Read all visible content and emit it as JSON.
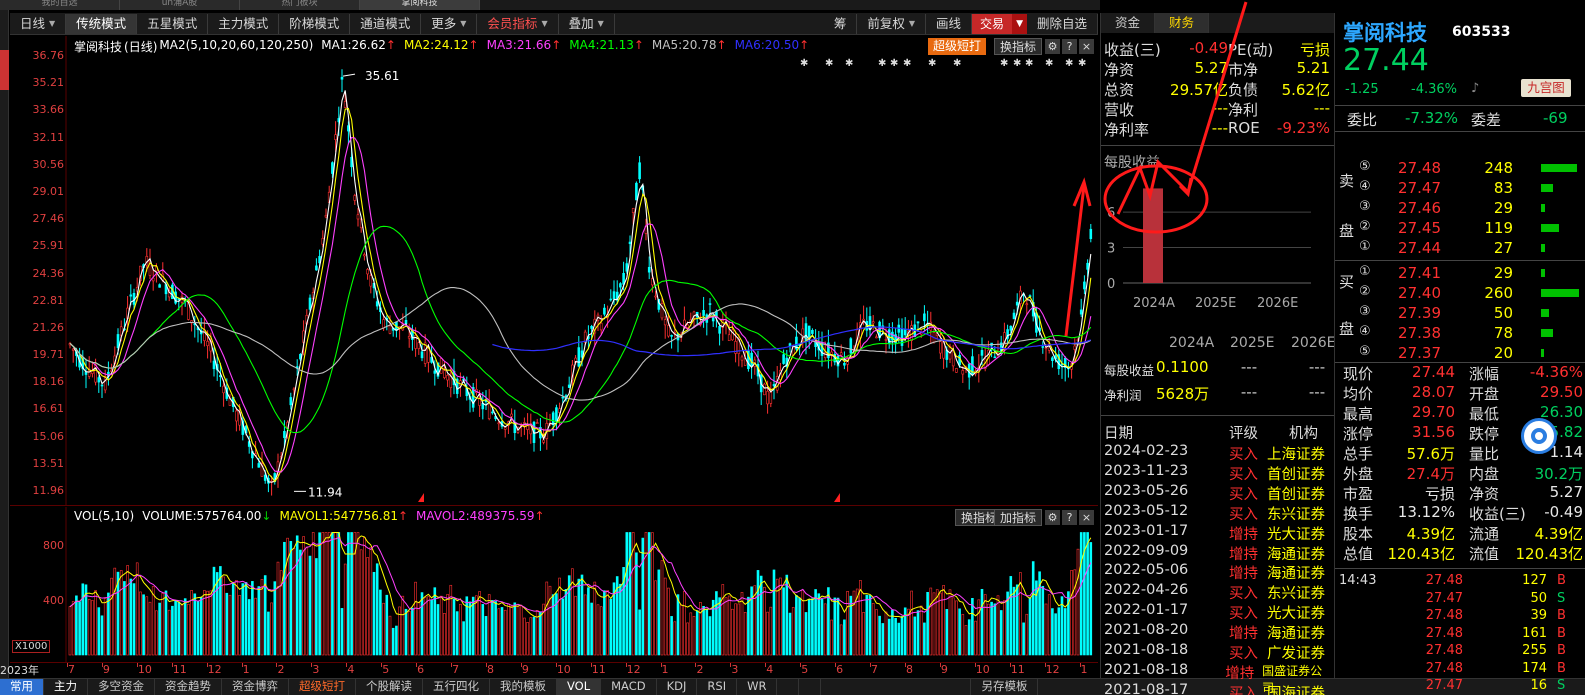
{
  "top_tabs": [
    "我的自选",
    "un浦A股",
    "热门板块",
    "掌阅科技"
  ],
  "mode_bar": {
    "items": [
      "日线",
      "传统模式",
      "五星模式",
      "主力模式",
      "阶梯模式",
      "通道模式",
      "更多",
      "会员指标",
      "叠加"
    ],
    "right": [
      "筹",
      "前复权",
      "画线",
      "交易",
      "删除自选"
    ]
  },
  "chart": {
    "name": "掌阅科技",
    "period": "(日线)",
    "ma_label": "MA2(5,10,20,60,120,250)",
    "ma": [
      {
        "label": "MA1:26.62",
        "color": "#ffffff"
      },
      {
        "label": "MA2:24.12",
        "color": "#ffff00"
      },
      {
        "label": "MA3:21.66",
        "color": "#ff40ff"
      },
      {
        "label": "MA4:21.13",
        "color": "#00ff00"
      },
      {
        "label": "MA5:20.78",
        "color": "#c0c0c0"
      },
      {
        "label": "MA6:20.50",
        "color": "#3030ff"
      }
    ],
    "super_btn": "超级短打",
    "indicator_btn": "换指标",
    "y_ticks": [
      "36.76",
      "35.21",
      "33.66",
      "32.11",
      "30.56",
      "29.01",
      "27.46",
      "25.91",
      "24.36",
      "22.81",
      "21.26",
      "19.71",
      "18.16",
      "16.61",
      "15.06",
      "13.51",
      "11.96"
    ],
    "high_label": "35.61",
    "low_label": "11.94"
  },
  "volume": {
    "label": "VOL(5,10)",
    "volume_text": "VOLUME:575764.00",
    "mavol1": "MAVOL1:547756.81",
    "mavol2": "MAVOL2:489375.59",
    "y_ticks": [
      "800",
      "400"
    ],
    "unit": "X1000",
    "change_indicator": "换指标",
    "add_indicator": "加指标"
  },
  "months": [
    "7",
    "9",
    "10",
    "11",
    "12",
    "1",
    "2",
    "3",
    "4",
    "5",
    "6",
    "7",
    "8",
    "9",
    "10",
    "11",
    "12",
    "1",
    "2",
    "3",
    "4",
    "5",
    "6",
    "7",
    "8",
    "9",
    "10",
    "11",
    "12",
    "1"
  ],
  "year_label": "2023年",
  "bottom_tabs": [
    "常用",
    "主力",
    "多空资金",
    "资金趋势",
    "资金博弈",
    "超级短打",
    "个股解读",
    "五行四化",
    "我的模板",
    "VOL",
    "MACD",
    "KDJ",
    "RSI",
    "WR",
    "",
    "",
    "",
    "另存模板"
  ],
  "finance": {
    "tabs": [
      "资金",
      "财务"
    ],
    "rows": [
      {
        "l1": "收益(三)",
        "v1": "-0.49",
        "l2": "PE(动)",
        "v2": "亏损"
      },
      {
        "l1": "净资",
        "v1": "5.27",
        "l2": "市净",
        "v2": "5.21"
      },
      {
        "l1": "总资",
        "v1": "29.57亿",
        "l2": "负债",
        "v2": "5.62亿"
      },
      {
        "l1": "营收",
        "v1": "---",
        "l2": "净利",
        "v2": "---"
      },
      {
        "l1": "净利率",
        "v1": "---",
        "l2": "ROE",
        "v2": "-9.23%"
      }
    ],
    "eps_title": "每股收益",
    "eps_y_ticks": [
      "6",
      "3",
      "0"
    ],
    "eps_x": [
      "2024A",
      "2025E",
      "2026E"
    ],
    "eps_chart": {
      "type": "bar",
      "categories": [
        "2024A",
        "2025E",
        "2026E"
      ],
      "values": [
        8,
        null,
        null
      ],
      "ylim": [
        0,
        9
      ]
    },
    "table_headers": [
      "2024A",
      "2025E",
      "2026E"
    ],
    "table_rows": [
      {
        "label": "每股收益",
        "values": [
          "0.1100",
          "---",
          "---"
        ]
      },
      {
        "label": "净利润",
        "values": [
          "5628万",
          "---",
          "---"
        ]
      }
    ],
    "rating_headers": [
      "日期",
      "评级",
      "机构"
    ],
    "ratings": [
      {
        "date": "2024-02-23",
        "rating": "买入",
        "org": "上海证券"
      },
      {
        "date": "2023-11-23",
        "rating": "买入",
        "org": "首创证券"
      },
      {
        "date": "2023-05-26",
        "rating": "买入",
        "org": "首创证券"
      },
      {
        "date": "2023-05-12",
        "rating": "买入",
        "org": "东兴证券"
      },
      {
        "date": "2023-01-17",
        "rating": "增持",
        "org": "光大证券"
      },
      {
        "date": "2022-09-09",
        "rating": "增持",
        "org": "海通证券"
      },
      {
        "date": "2022-05-06",
        "rating": "增持",
        "org": "海通证券"
      },
      {
        "date": "2022-04-26",
        "rating": "买入",
        "org": "东兴证券"
      },
      {
        "date": "2022-01-17",
        "rating": "买入",
        "org": "光大证券"
      },
      {
        "date": "2021-08-20",
        "rating": "增持",
        "org": "海通证券"
      },
      {
        "date": "2021-08-18",
        "rating": "买入",
        "org": "广发证券"
      },
      {
        "date": "2021-08-18",
        "rating": "增持",
        "org": "国盛证券公司"
      },
      {
        "date": "2021-08-17",
        "rating": "买入",
        "org": "国海证券"
      }
    ]
  },
  "quote": {
    "name": "掌阅科技",
    "code": "603533",
    "price": "27.44",
    "change": "-1.25",
    "change_pct": "-4.36%",
    "nine_btn": "九宫图",
    "weibi_label": "委比",
    "weibi": "-7.32%",
    "weicha_label": "委差",
    "weicha": "-69",
    "sell_label": [
      "卖",
      "盘"
    ],
    "buy_label": [
      "买",
      "盘"
    ],
    "sells": [
      {
        "lvl": "⑤",
        "price": "27.48",
        "vol": "248",
        "bar": 0.9
      },
      {
        "lvl": "④",
        "price": "27.47",
        "vol": "83",
        "bar": 0.3
      },
      {
        "lvl": "③",
        "price": "27.46",
        "vol": "29",
        "bar": 0.1
      },
      {
        "lvl": "②",
        "price": "27.45",
        "vol": "119",
        "bar": 0.45
      },
      {
        "lvl": "①",
        "price": "27.44",
        "vol": "27",
        "bar": 0.1
      }
    ],
    "buys": [
      {
        "lvl": "①",
        "price": "27.41",
        "vol": "29",
        "bar": 0.1
      },
      {
        "lvl": "②",
        "price": "27.40",
        "vol": "260",
        "bar": 0.95
      },
      {
        "lvl": "③",
        "price": "27.39",
        "vol": "50",
        "bar": 0.2
      },
      {
        "lvl": "④",
        "price": "27.38",
        "vol": "78",
        "bar": 0.3
      },
      {
        "lvl": "⑤",
        "price": "27.37",
        "vol": "20",
        "bar": 0.08
      }
    ],
    "stats": [
      {
        "l1": "现价",
        "v1": "27.44",
        "c1": "red",
        "l2": "涨幅",
        "v2": "-4.36%",
        "c2": "red"
      },
      {
        "l1": "均价",
        "v1": "28.07",
        "c1": "red",
        "l2": "开盘",
        "v2": "29.50",
        "c2": "red"
      },
      {
        "l1": "最高",
        "v1": "29.70",
        "c1": "red",
        "l2": "最低",
        "v2": "26.30",
        "c2": "green"
      },
      {
        "l1": "涨停",
        "v1": "31.56",
        "c1": "red",
        "l2": "跌停",
        "v2": "25.82",
        "c2": "green"
      },
      {
        "l1": "总手",
        "v1": "57.6万",
        "c1": "yellow",
        "l2": "量比",
        "v2": "1.14",
        "c2": "white"
      },
      {
        "l1": "外盘",
        "v1": "27.4万",
        "c1": "red",
        "l2": "内盘",
        "v2": "30.2万",
        "c2": "green"
      },
      {
        "l1": "市盈",
        "v1": "亏损",
        "c1": "white",
        "l2": "净资",
        "v2": "5.27",
        "c2": "white"
      },
      {
        "l1": "换手",
        "v1": "13.12%",
        "c1": "white",
        "l2": "收益(三)",
        "v2": "-0.49",
        "c2": "white"
      },
      {
        "l1": "股本",
        "v1": "4.39亿",
        "c1": "yellow",
        "l2": "流通",
        "v2": "4.39亿",
        "c2": "yellow"
      },
      {
        "l1": "总值",
        "v1": "120.43亿",
        "c1": "yellow",
        "l2": "流值",
        "v2": "120.43亿",
        "c2": "yellow"
      }
    ],
    "ticks": [
      {
        "time": "14:43",
        "price": "27.48",
        "vol": "127",
        "dir": "B"
      },
      {
        "time": "",
        "price": "27.47",
        "vol": "50",
        "dir": "S"
      },
      {
        "time": "",
        "price": "27.48",
        "vol": "39",
        "dir": "B"
      },
      {
        "time": "",
        "price": "27.48",
        "vol": "161",
        "dir": "B"
      },
      {
        "time": "",
        "price": "27.48",
        "vol": "255",
        "dir": "B"
      },
      {
        "time": "",
        "price": "27.48",
        "vol": "174",
        "dir": "B"
      },
      {
        "time": "",
        "price": "27.47",
        "vol": "16",
        "dir": "S"
      }
    ]
  },
  "colors": {
    "up": "#ff3030",
    "down": "#00ffff",
    "accent": "#ff3030",
    "bg": "#000000"
  }
}
